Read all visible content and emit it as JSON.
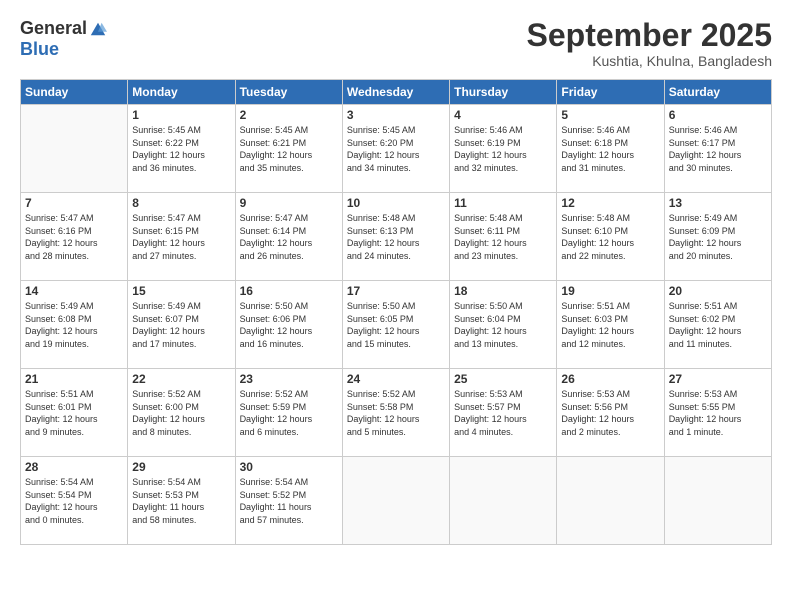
{
  "logo": {
    "general": "General",
    "blue": "Blue"
  },
  "title": "September 2025",
  "location": "Kushtia, Khulna, Bangladesh",
  "days_of_week": [
    "Sunday",
    "Monday",
    "Tuesday",
    "Wednesday",
    "Thursday",
    "Friday",
    "Saturday"
  ],
  "weeks": [
    [
      {
        "day": "",
        "info": ""
      },
      {
        "day": "1",
        "info": "Sunrise: 5:45 AM\nSunset: 6:22 PM\nDaylight: 12 hours\nand 36 minutes."
      },
      {
        "day": "2",
        "info": "Sunrise: 5:45 AM\nSunset: 6:21 PM\nDaylight: 12 hours\nand 35 minutes."
      },
      {
        "day": "3",
        "info": "Sunrise: 5:45 AM\nSunset: 6:20 PM\nDaylight: 12 hours\nand 34 minutes."
      },
      {
        "day": "4",
        "info": "Sunrise: 5:46 AM\nSunset: 6:19 PM\nDaylight: 12 hours\nand 32 minutes."
      },
      {
        "day": "5",
        "info": "Sunrise: 5:46 AM\nSunset: 6:18 PM\nDaylight: 12 hours\nand 31 minutes."
      },
      {
        "day": "6",
        "info": "Sunrise: 5:46 AM\nSunset: 6:17 PM\nDaylight: 12 hours\nand 30 minutes."
      }
    ],
    [
      {
        "day": "7",
        "info": "Sunrise: 5:47 AM\nSunset: 6:16 PM\nDaylight: 12 hours\nand 28 minutes."
      },
      {
        "day": "8",
        "info": "Sunrise: 5:47 AM\nSunset: 6:15 PM\nDaylight: 12 hours\nand 27 minutes."
      },
      {
        "day": "9",
        "info": "Sunrise: 5:47 AM\nSunset: 6:14 PM\nDaylight: 12 hours\nand 26 minutes."
      },
      {
        "day": "10",
        "info": "Sunrise: 5:48 AM\nSunset: 6:13 PM\nDaylight: 12 hours\nand 24 minutes."
      },
      {
        "day": "11",
        "info": "Sunrise: 5:48 AM\nSunset: 6:11 PM\nDaylight: 12 hours\nand 23 minutes."
      },
      {
        "day": "12",
        "info": "Sunrise: 5:48 AM\nSunset: 6:10 PM\nDaylight: 12 hours\nand 22 minutes."
      },
      {
        "day": "13",
        "info": "Sunrise: 5:49 AM\nSunset: 6:09 PM\nDaylight: 12 hours\nand 20 minutes."
      }
    ],
    [
      {
        "day": "14",
        "info": "Sunrise: 5:49 AM\nSunset: 6:08 PM\nDaylight: 12 hours\nand 19 minutes."
      },
      {
        "day": "15",
        "info": "Sunrise: 5:49 AM\nSunset: 6:07 PM\nDaylight: 12 hours\nand 17 minutes."
      },
      {
        "day": "16",
        "info": "Sunrise: 5:50 AM\nSunset: 6:06 PM\nDaylight: 12 hours\nand 16 minutes."
      },
      {
        "day": "17",
        "info": "Sunrise: 5:50 AM\nSunset: 6:05 PM\nDaylight: 12 hours\nand 15 minutes."
      },
      {
        "day": "18",
        "info": "Sunrise: 5:50 AM\nSunset: 6:04 PM\nDaylight: 12 hours\nand 13 minutes."
      },
      {
        "day": "19",
        "info": "Sunrise: 5:51 AM\nSunset: 6:03 PM\nDaylight: 12 hours\nand 12 minutes."
      },
      {
        "day": "20",
        "info": "Sunrise: 5:51 AM\nSunset: 6:02 PM\nDaylight: 12 hours\nand 11 minutes."
      }
    ],
    [
      {
        "day": "21",
        "info": "Sunrise: 5:51 AM\nSunset: 6:01 PM\nDaylight: 12 hours\nand 9 minutes."
      },
      {
        "day": "22",
        "info": "Sunrise: 5:52 AM\nSunset: 6:00 PM\nDaylight: 12 hours\nand 8 minutes."
      },
      {
        "day": "23",
        "info": "Sunrise: 5:52 AM\nSunset: 5:59 PM\nDaylight: 12 hours\nand 6 minutes."
      },
      {
        "day": "24",
        "info": "Sunrise: 5:52 AM\nSunset: 5:58 PM\nDaylight: 12 hours\nand 5 minutes."
      },
      {
        "day": "25",
        "info": "Sunrise: 5:53 AM\nSunset: 5:57 PM\nDaylight: 12 hours\nand 4 minutes."
      },
      {
        "day": "26",
        "info": "Sunrise: 5:53 AM\nSunset: 5:56 PM\nDaylight: 12 hours\nand 2 minutes."
      },
      {
        "day": "27",
        "info": "Sunrise: 5:53 AM\nSunset: 5:55 PM\nDaylight: 12 hours\nand 1 minute."
      }
    ],
    [
      {
        "day": "28",
        "info": "Sunrise: 5:54 AM\nSunset: 5:54 PM\nDaylight: 12 hours\nand 0 minutes."
      },
      {
        "day": "29",
        "info": "Sunrise: 5:54 AM\nSunset: 5:53 PM\nDaylight: 11 hours\nand 58 minutes."
      },
      {
        "day": "30",
        "info": "Sunrise: 5:54 AM\nSunset: 5:52 PM\nDaylight: 11 hours\nand 57 minutes."
      },
      {
        "day": "",
        "info": ""
      },
      {
        "day": "",
        "info": ""
      },
      {
        "day": "",
        "info": ""
      },
      {
        "day": "",
        "info": ""
      }
    ]
  ]
}
